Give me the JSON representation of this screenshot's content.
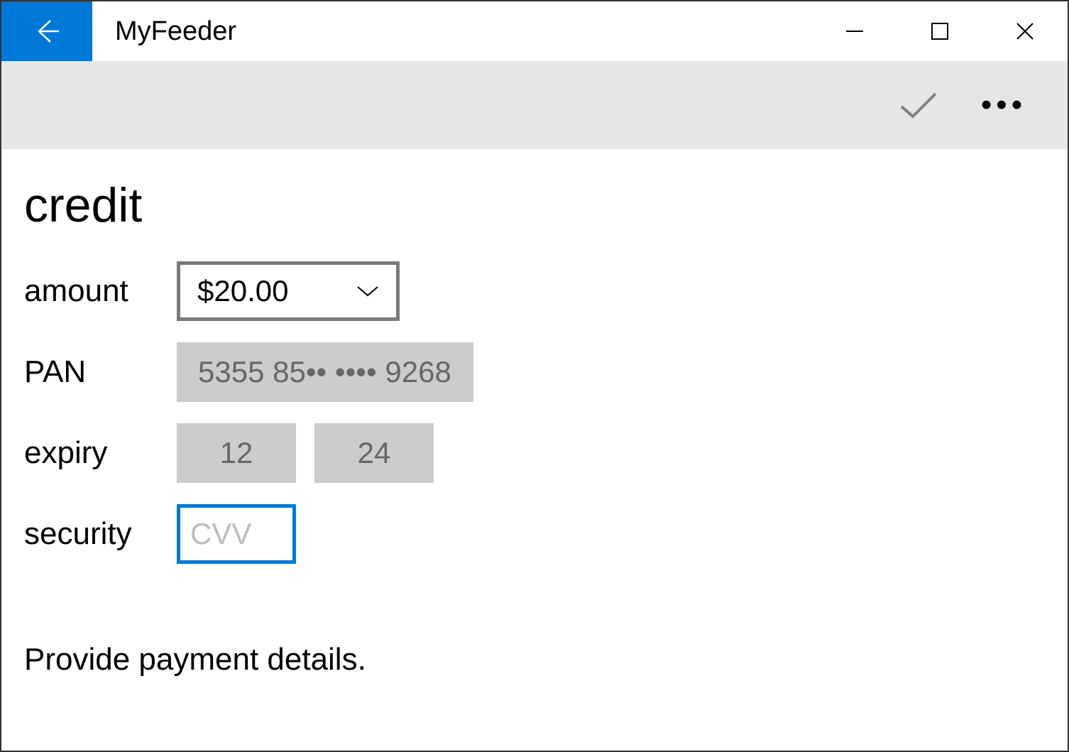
{
  "titlebar": {
    "app_title": "MyFeeder"
  },
  "page": {
    "heading": "credit",
    "helper_text": "Provide payment details."
  },
  "form": {
    "amount": {
      "label": "amount",
      "value": "$20.00"
    },
    "pan": {
      "label": "PAN",
      "value": "5355 85•• •••• 9268"
    },
    "expiry": {
      "label": "expiry",
      "month": "12",
      "year": "24"
    },
    "security": {
      "label": "security",
      "placeholder": "CVV",
      "value": ""
    }
  }
}
